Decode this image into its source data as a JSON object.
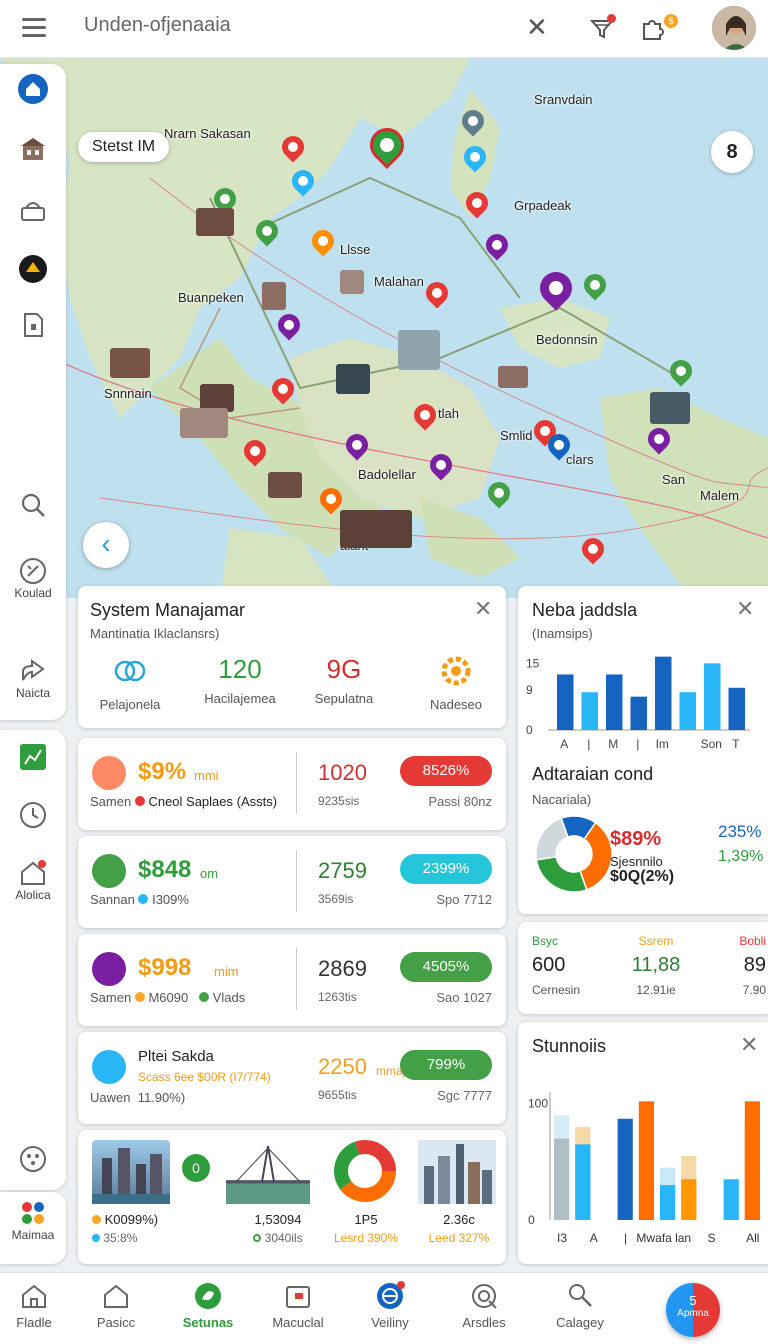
{
  "topbar": {
    "search_text": "Unden-ofjenaaia",
    "close_glyph": "✕"
  },
  "map": {
    "chip_label": "Stetst IM",
    "count": "8",
    "labels": [
      {
        "text": "Nrarn Sakasan"
      },
      {
        "text": "Sranvdain"
      },
      {
        "text": "Grpadeak"
      },
      {
        "text": "Llsse"
      },
      {
        "text": "Malahan"
      },
      {
        "text": "Buanpeken"
      },
      {
        "text": "Bedonnsin"
      },
      {
        "text": "Snnnain"
      },
      {
        "text": "Badolellar"
      },
      {
        "text": "Smlid"
      },
      {
        "text": "clars"
      },
      {
        "text": "San"
      },
      {
        "text": "Malem"
      },
      {
        "text": "alant"
      },
      {
        "text": "tlah"
      }
    ],
    "back_glyph": "‹"
  },
  "sidebar": {
    "items": [
      {
        "label": ""
      },
      {
        "label": ""
      },
      {
        "label": ""
      },
      {
        "label": ""
      },
      {
        "label": ""
      },
      {
        "label": ""
      },
      {
        "label": "Koulad"
      },
      {
        "label": "Naicta"
      },
      {
        "label": ""
      },
      {
        "label": ""
      },
      {
        "label": "Alolica"
      },
      {
        "label": ""
      },
      {
        "label": "Maimaa"
      }
    ]
  },
  "system_card": {
    "title": "System Manajamar",
    "subtitle": "Mantinatia Iklaclansrs)",
    "stats": [
      {
        "value": "",
        "label": "Pelajonela"
      },
      {
        "value": "120",
        "label": "Hacilajemea",
        "color": "#2e9e3c"
      },
      {
        "value": "9G",
        "label": "Sepulatna",
        "color": "#d32f2f"
      },
      {
        "value": "",
        "label": "Nadeseo"
      }
    ]
  },
  "metric_rows": [
    {
      "value": "$9%",
      "unit": "mmi",
      "sub_a": "Samen",
      "sub_b": "Cneol Saplaes (Assts)",
      "num": "1020",
      "num_sub": "9235sis",
      "pill": "8526%",
      "pill_sub": "Passi 80nz",
      "val_color": "#f39c12",
      "num_color": "#d32f2f",
      "pill_color": "#e53935"
    },
    {
      "value": "$848",
      "unit": "om",
      "sub_a": "Sannan",
      "sub_b": "I309%",
      "num": "2759",
      "num_sub": "3569is",
      "pill": "2399%",
      "pill_sub": "Spo 7712",
      "val_color": "#2e9e3c",
      "num_color": "#2e7d32",
      "pill_color": "#26c6da"
    },
    {
      "value": "$998",
      "unit": "mim",
      "sub_a": "Samen",
      "sub_b": "M6090",
      "sub_c": "Vlads",
      "num": "2869",
      "num_sub": "1263tis",
      "pill": "4505%",
      "pill_sub": "Sao 1027",
      "val_color": "#f39c12",
      "num_color": "#333",
      "pill_color": "#43a047"
    },
    {
      "value": "Pltei Sakda",
      "unit": "",
      "sub_a": "Uawen",
      "sub_b": "11.90%)",
      "sub_c": "Scass 6ee $00R (I7/774)",
      "num": "2250",
      "num_unit": "mmaj",
      "num_sub": "9655tis",
      "pill": "799%",
      "pill_sub": "Sgc 7777",
      "val_color": "#222",
      "num_color": "#f0a020",
      "pill_color": "#43a047"
    }
  ],
  "gallery": {
    "items": [
      {
        "main": "K0099%)",
        "sub": "35:8%"
      },
      {
        "main": "1,53094",
        "sub": "3040ils"
      },
      {
        "main": "1P5",
        "sub": "Lesrd 390%"
      },
      {
        "main": "2.36c",
        "sub": "Leed 327%"
      }
    ],
    "badge": "0"
  },
  "neba_card": {
    "title": "Neba jaddsla",
    "subtitle": "(Inamsips)",
    "close_glyph": "✕"
  },
  "adtaraian": {
    "title": "Adtaraian cond",
    "subtitle": "Nacariala)",
    "pie_value": "$89%",
    "pie_caption_1": "Sjesnnilo",
    "pie_caption_2": "$0Q(2%)",
    "side_1": "235%",
    "side_2": "1,39%"
  },
  "stats_strip": {
    "items": [
      {
        "head": "Bsyc",
        "value": "600",
        "sub": "Cernesin",
        "head_color": "#2e9e3c",
        "val_color": "#222"
      },
      {
        "head": "Ssrem",
        "value": "11,88",
        "sub": "12.91ie",
        "head_color": "#f39c12",
        "val_color": "#2e7d32"
      },
      {
        "head": "Bobli",
        "value": "89",
        "sub": "7.90",
        "head_color": "#e53935",
        "val_color": "#222"
      }
    ]
  },
  "stunnoiis": {
    "title": "Stunnoiis",
    "close_glyph": "✕"
  },
  "chart_data": [
    {
      "type": "bar",
      "title": "Neba jaddsla",
      "categories": [
        "A",
        "",
        "M",
        "",
        "Im",
        "",
        "Son",
        "T"
      ],
      "tick_labels": [
        {
          "text": "A",
          "at": 0
        },
        {
          "text": "|",
          "at": 1
        },
        {
          "text": "M",
          "at": 2
        },
        {
          "text": "|",
          "at": 3
        },
        {
          "text": "Im",
          "at": 4
        },
        {
          "text": "Son",
          "at": 6
        },
        {
          "text": "T",
          "at": 7
        }
      ],
      "series": [
        {
          "values": [
            12.5,
            8.5,
            12.5,
            7.5,
            16.5,
            8.5,
            15,
            9.5
          ],
          "colors": [
            "#1565c0",
            "#29b6f6",
            "#1565c0",
            "#1565c0",
            "#1565c0",
            "#29b6f6",
            "#29b6f6",
            "#1565c0"
          ]
        }
      ],
      "yticks": [
        0,
        9,
        15
      ],
      "ylim": [
        0,
        18
      ]
    },
    {
      "type": "pie",
      "title": "Adtaraian cond",
      "slices": [
        {
          "value": 35,
          "color": "#ff6d00"
        },
        {
          "value": 28,
          "color": "#2e9e3c"
        },
        {
          "value": 22,
          "color": "#cfd8dc"
        },
        {
          "value": 15,
          "color": "#1565c0"
        }
      ]
    },
    {
      "type": "bar",
      "title": "Stunnoiis",
      "tick_labels": [
        {
          "text": "I3",
          "at": 0
        },
        {
          "text": "A",
          "at": 1
        },
        {
          "text": "|",
          "at": 2
        },
        {
          "text": "Mwafa lan",
          "at": 3.2
        },
        {
          "text": "S",
          "at": 4.7
        },
        {
          "text": "All",
          "at": 6
        }
      ],
      "groups": [
        {
          "base": 70,
          "top": 90,
          "base_color": "#b0bec5",
          "top_color": "#d6ecf7"
        },
        {
          "base": 65,
          "top": 80,
          "base_color": "#29b6f6",
          "top_color": "#f5d9a6"
        },
        {
          "base": 0,
          "top": 0,
          "base_color": "#fff",
          "top_color": "#fff"
        },
        {
          "base": 87,
          "top": 87,
          "base_color": "#1565c0",
          "top_color": "#1565c0"
        },
        {
          "base": 102,
          "top": 102,
          "base_color": "#ff6d00",
          "top_color": "#ff6d00"
        },
        {
          "base": 30,
          "top": 45,
          "base_color": "#29b6f6",
          "top_color": "#c8eaf7"
        },
        {
          "base": 35,
          "top": 55,
          "base_color": "#ff9800",
          "top_color": "#f5d9a6"
        },
        {
          "base": 0,
          "top": 0,
          "base_color": "#fff",
          "top_color": "#fff"
        },
        {
          "base": 35,
          "top": 35,
          "base_color": "#29b6f6",
          "top_color": "#29b6f6"
        },
        {
          "base": 85,
          "top": 102,
          "base_color": "#ff6d00",
          "top_color": "#ff6d00"
        }
      ],
      "yticks": [
        0,
        100
      ],
      "ylim": [
        0,
        110
      ]
    }
  ],
  "bottom_nav": {
    "items": [
      {
        "label": "Fladle"
      },
      {
        "label": "Pasicc"
      },
      {
        "label": "Setunas"
      },
      {
        "label": "Macuclal"
      },
      {
        "label": "Veiliny"
      },
      {
        "label": "Arsdles"
      },
      {
        "label": "Calagey"
      }
    ],
    "fab_label": "Apmna",
    "fab_num": "5"
  },
  "colors": {
    "accent": "#1565c0",
    "green": "#2e9e3c",
    "orange": "#f39c12",
    "red": "#e53935",
    "cyan": "#29b6f6"
  }
}
